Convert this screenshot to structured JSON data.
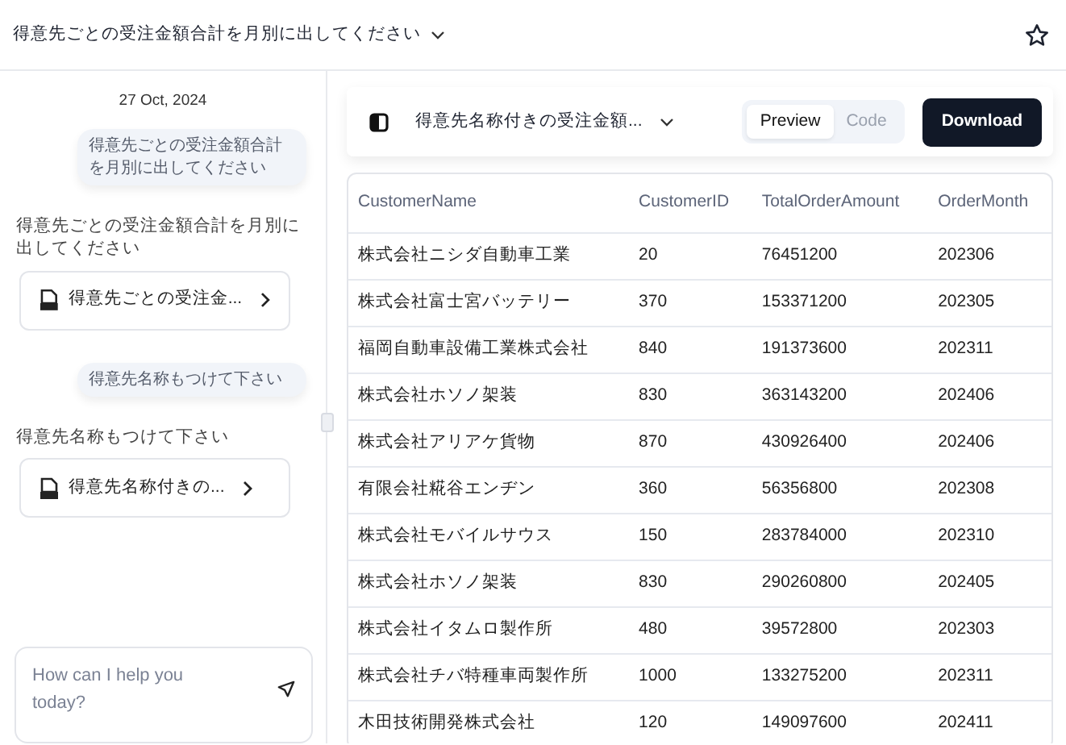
{
  "header": {
    "title": "得意先ごとの受注金額合計を月別に出してください"
  },
  "chat": {
    "date": "27 Oct, 2024",
    "messages": [
      {
        "kind": "user",
        "text": "得意先ごとの受注金額合計を月別に出してください"
      },
      {
        "kind": "assistant",
        "text": "得意先ごとの受注金額合計を月別に出してください",
        "artifact": "得意先ごとの受注金..."
      },
      {
        "kind": "user",
        "text": "得意先名称もつけて下さい"
      },
      {
        "kind": "assistant",
        "text": "得意先名称もつけて下さい",
        "artifact": "得意先名称付きの..."
      }
    ],
    "input": {
      "placeholder": "How can I help you today?"
    }
  },
  "preview": {
    "title": "得意先名称付きの受注金額...",
    "tabs": [
      {
        "label": "Preview",
        "selected": true
      },
      {
        "label": "Code",
        "selected": false
      }
    ],
    "download": "Download",
    "table": {
      "columns": [
        "CustomerName",
        "CustomerID",
        "TotalOrderAmount",
        "OrderMonth"
      ],
      "rows": [
        [
          "株式会社ニシダ自動車工業",
          "20",
          "76451200",
          "202306"
        ],
        [
          "株式会社富士宮バッテリー",
          "370",
          "153371200",
          "202305"
        ],
        [
          "福岡自動車設備工業株式会社",
          "840",
          "191373600",
          "202311"
        ],
        [
          "株式会社ホソノ架装",
          "830",
          "363143200",
          "202406"
        ],
        [
          "株式会社アリアケ貨物",
          "870",
          "430926400",
          "202406"
        ],
        [
          "有限会社糀谷エンヂン",
          "360",
          "56356800",
          "202308"
        ],
        [
          "株式会社モバイルサウス",
          "150",
          "283784000",
          "202310"
        ],
        [
          "株式会社ホソノ架装",
          "830",
          "290260800",
          "202405"
        ],
        [
          "株式会社イタムロ製作所",
          "480",
          "39572800",
          "202303"
        ],
        [
          "株式会社チバ特種車両製作所",
          "1000",
          "133275200",
          "202311"
        ],
        [
          "木田技術開発株式会社",
          "120",
          "149097600",
          "202411"
        ]
      ]
    }
  }
}
